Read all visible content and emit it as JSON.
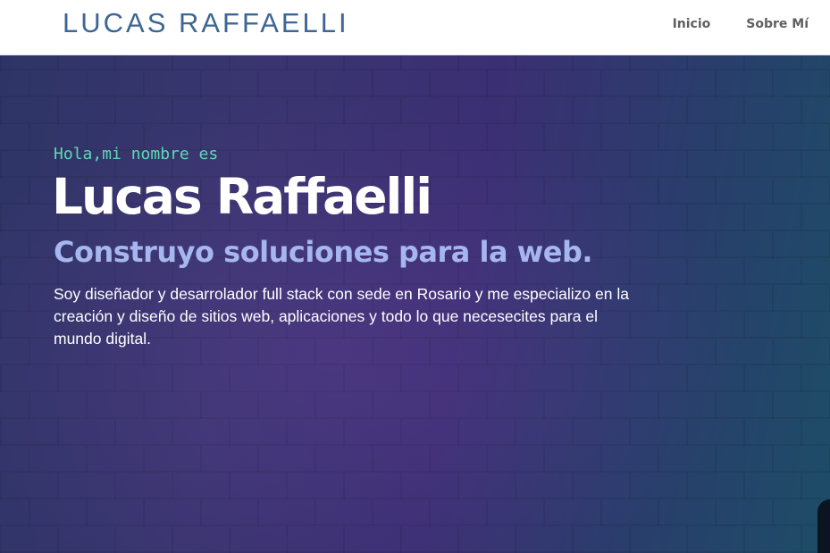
{
  "header": {
    "brand": "LUCAS RAFFAELLI",
    "nav": [
      {
        "label": "Inicio"
      },
      {
        "label": "Sobre Mí"
      }
    ]
  },
  "hero": {
    "greeting": "Hola,mi nombre es",
    "name": "Lucas Raffaelli",
    "tagline": "Construyo soluciones para la web.",
    "bio": "Soy diseñador y desarrolador full stack con sede en Rosario y me especializo en la creación y diseño de sitios web, aplicaciones y todo lo que necesecites para el mundo digital."
  },
  "colors": {
    "brand": "#3e6694",
    "greeting": "#5ed9b1",
    "tagline": "#a6b6ee",
    "hero_bg": "#3b2f73"
  }
}
